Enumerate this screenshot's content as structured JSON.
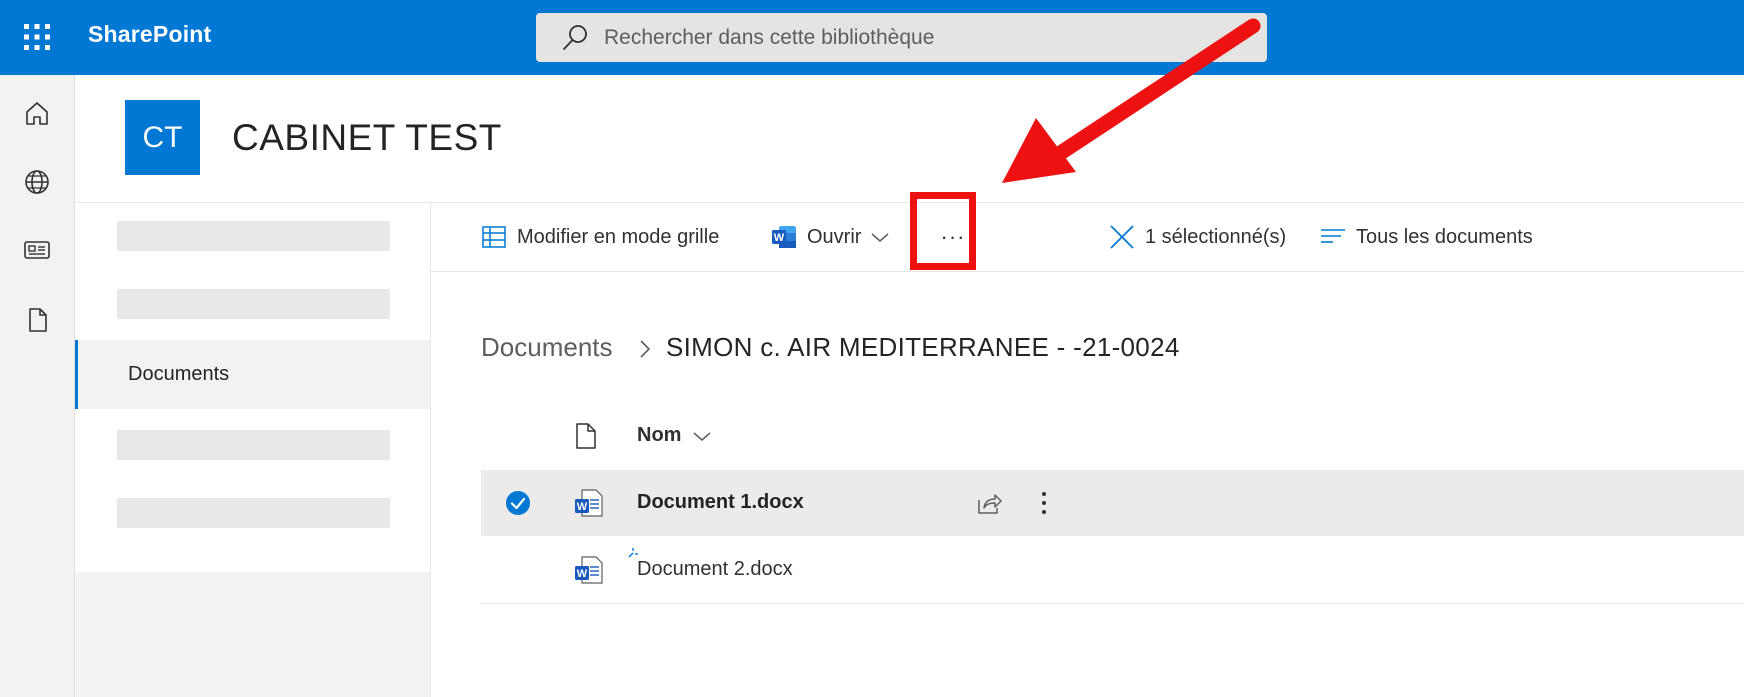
{
  "topbar": {
    "app_name": "SharePoint",
    "search_placeholder": "Rechercher dans cette bibliothèque"
  },
  "rail": {
    "items": [
      "home-icon",
      "globe-icon",
      "news-icon",
      "file-icon"
    ]
  },
  "site": {
    "logo_text": "CT",
    "title": "CABINET TEST"
  },
  "leftnav": {
    "active_item": "Documents"
  },
  "commandbar": {
    "grid_label": "Modifier en mode grille",
    "open_label": "Ouvrir",
    "more_label": "···",
    "selected_label": "1 sélectionné(s)",
    "view_label": "Tous les documents"
  },
  "breadcrumb": {
    "root": "Documents",
    "current": "SIMON c. AIR MEDITERRANEE - -21-0024"
  },
  "list": {
    "column_name": "Nom",
    "rows": [
      {
        "name": "Document 1.docx",
        "selected": true
      },
      {
        "name": "Document 2.docx",
        "selected": false
      }
    ]
  },
  "colors": {
    "brand": "#0078d4",
    "annotation": "#ee1111",
    "selected_row": "#edebe9"
  }
}
